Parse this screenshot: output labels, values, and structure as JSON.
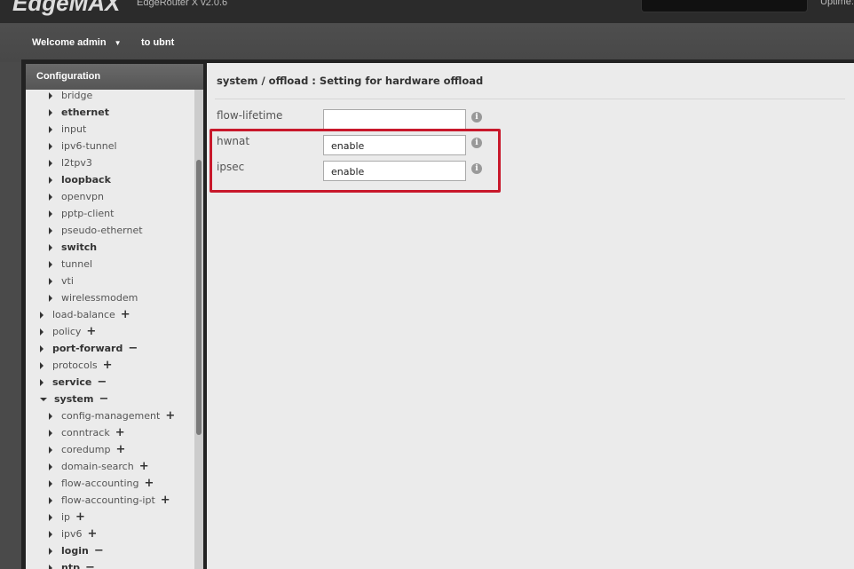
{
  "header": {
    "logo": "EdgeMAX",
    "version": "EdgeRouter X v2.0.6",
    "uptime_label": "Uptime:"
  },
  "nav": {
    "welcome": "Welcome admin",
    "to_ubnt": "to ubnt"
  },
  "sidebar": {
    "title": "Configuration",
    "items": [
      {
        "label": "bridge",
        "level": 2,
        "bold": false,
        "sign": ""
      },
      {
        "label": "ethernet",
        "level": 2,
        "bold": true,
        "sign": ""
      },
      {
        "label": "input",
        "level": 2,
        "bold": false,
        "sign": ""
      },
      {
        "label": "ipv6-tunnel",
        "level": 2,
        "bold": false,
        "sign": ""
      },
      {
        "label": "l2tpv3",
        "level": 2,
        "bold": false,
        "sign": ""
      },
      {
        "label": "loopback",
        "level": 2,
        "bold": true,
        "sign": ""
      },
      {
        "label": "openvpn",
        "level": 2,
        "bold": false,
        "sign": ""
      },
      {
        "label": "pptp-client",
        "level": 2,
        "bold": false,
        "sign": ""
      },
      {
        "label": "pseudo-ethernet",
        "level": 2,
        "bold": false,
        "sign": ""
      },
      {
        "label": "switch",
        "level": 2,
        "bold": true,
        "sign": ""
      },
      {
        "label": "tunnel",
        "level": 2,
        "bold": false,
        "sign": ""
      },
      {
        "label": "vti",
        "level": 2,
        "bold": false,
        "sign": ""
      },
      {
        "label": "wirelessmodem",
        "level": 2,
        "bold": false,
        "sign": ""
      },
      {
        "label": "load-balance",
        "level": 1,
        "bold": false,
        "sign": "+"
      },
      {
        "label": "policy",
        "level": 1,
        "bold": false,
        "sign": "+"
      },
      {
        "label": "port-forward",
        "level": 1,
        "bold": true,
        "sign": "−"
      },
      {
        "label": "protocols",
        "level": 1,
        "bold": false,
        "sign": "+"
      },
      {
        "label": "service",
        "level": 1,
        "bold": true,
        "sign": "−"
      },
      {
        "label": "system",
        "level": 1,
        "bold": true,
        "sign": "−",
        "expanded": true
      },
      {
        "label": "config-management",
        "level": 2,
        "bold": false,
        "sign": "+"
      },
      {
        "label": "conntrack",
        "level": 2,
        "bold": false,
        "sign": "+"
      },
      {
        "label": "coredump",
        "level": 2,
        "bold": false,
        "sign": "+"
      },
      {
        "label": "domain-search",
        "level": 2,
        "bold": false,
        "sign": "+"
      },
      {
        "label": "flow-accounting",
        "level": 2,
        "bold": false,
        "sign": "+"
      },
      {
        "label": "flow-accounting-ipt",
        "level": 2,
        "bold": false,
        "sign": "+"
      },
      {
        "label": "ip",
        "level": 2,
        "bold": false,
        "sign": "+"
      },
      {
        "label": "ipv6",
        "level": 2,
        "bold": false,
        "sign": "+"
      },
      {
        "label": "login",
        "level": 2,
        "bold": true,
        "sign": "−"
      },
      {
        "label": "ntp",
        "level": 2,
        "bold": true,
        "sign": "−"
      }
    ]
  },
  "main": {
    "title": "system / offload : Setting for hardware offload",
    "fields": [
      {
        "label": "flow-lifetime",
        "value": ""
      },
      {
        "label": "hwnat",
        "value": "enable"
      },
      {
        "label": "ipsec",
        "value": "enable"
      }
    ],
    "highlight_color": "#c8182b"
  }
}
